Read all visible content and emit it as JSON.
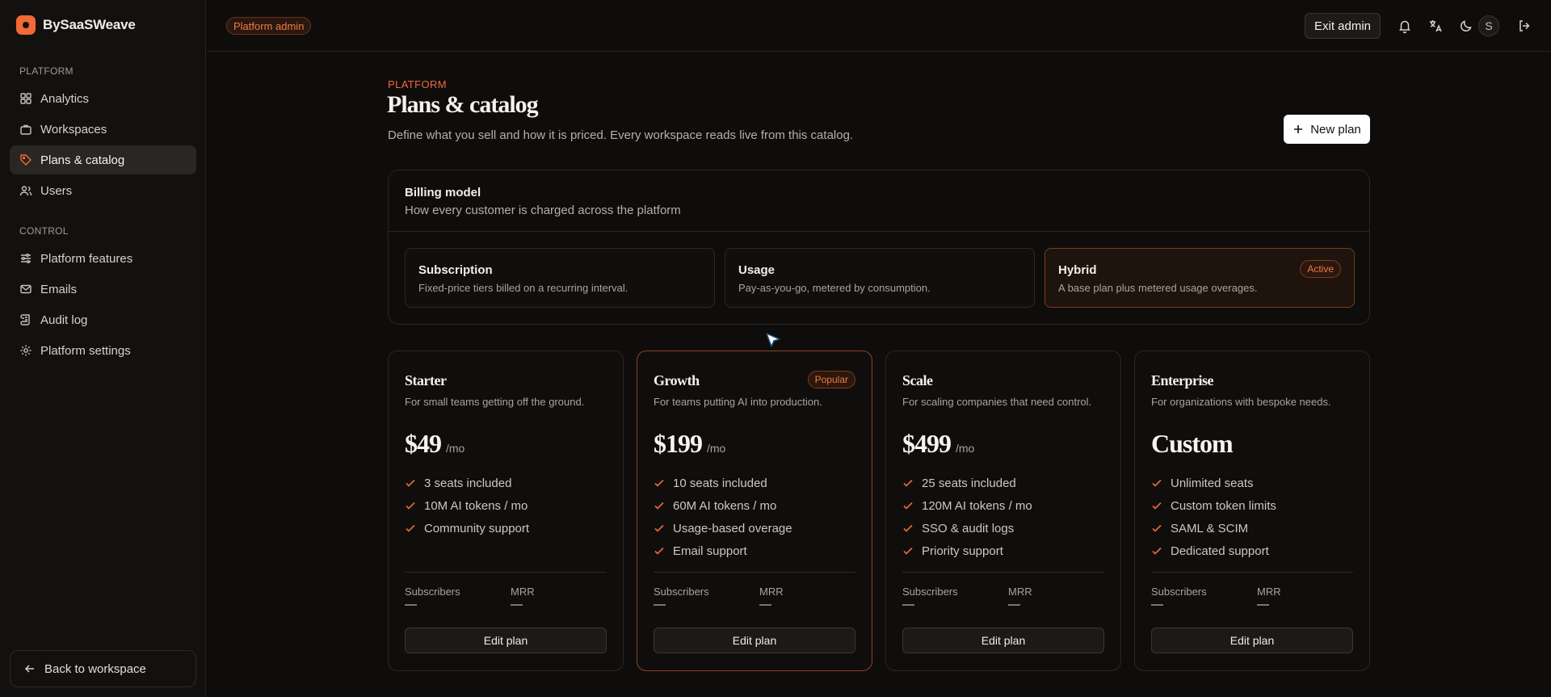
{
  "brand": {
    "name": "BySaaSWeave"
  },
  "sidebar": {
    "sections": [
      {
        "label": "PLATFORM",
        "items": [
          {
            "label": "Analytics",
            "icon": "grid-icon"
          },
          {
            "label": "Workspaces",
            "icon": "briefcase-icon"
          },
          {
            "label": "Plans & catalog",
            "icon": "tag-icon",
            "active": true
          },
          {
            "label": "Users",
            "icon": "users-icon"
          }
        ]
      },
      {
        "label": "CONTROL",
        "items": [
          {
            "label": "Platform features",
            "icon": "sliders-icon"
          },
          {
            "label": "Emails",
            "icon": "mail-icon"
          },
          {
            "label": "Audit log",
            "icon": "scroll-icon"
          },
          {
            "label": "Platform settings",
            "icon": "gear-icon"
          }
        ]
      }
    ],
    "back_label": "Back to workspace"
  },
  "topbar": {
    "admin_badge": "Platform admin",
    "exit_label": "Exit admin",
    "avatar_initial": "S"
  },
  "page": {
    "eyebrow": "PLATFORM",
    "title": "Plans & catalog",
    "subtitle": "Define what you sell and how it is priced. Every workspace reads live from this catalog.",
    "new_plan_label": "New plan"
  },
  "billing": {
    "title": "Billing model",
    "subtitle": "How every customer is charged across the platform",
    "models": [
      {
        "name": "Subscription",
        "desc": "Fixed-price tiers billed on a recurring interval."
      },
      {
        "name": "Usage",
        "desc": "Pay-as-you-go, metered by consumption."
      },
      {
        "name": "Hybrid",
        "desc": "A base plan plus metered usage overages.",
        "badge": "Active"
      }
    ]
  },
  "plans": [
    {
      "name": "Starter",
      "desc": "For small teams getting off the ground.",
      "price": "$49",
      "period": "/mo",
      "features": [
        "3 seats included",
        "10M AI tokens / mo",
        "Community support"
      ],
      "subscribers_label": "Subscribers",
      "subscribers": "—",
      "mrr_label": "MRR",
      "mrr": "—",
      "edit_label": "Edit plan"
    },
    {
      "name": "Growth",
      "desc": "For teams putting AI into production.",
      "price": "$199",
      "period": "/mo",
      "badge": "Popular",
      "features": [
        "10 seats included",
        "60M AI tokens / mo",
        "Usage-based overage",
        "Email support"
      ],
      "subscribers_label": "Subscribers",
      "subscribers": "—",
      "mrr_label": "MRR",
      "mrr": "—",
      "edit_label": "Edit plan"
    },
    {
      "name": "Scale",
      "desc": "For scaling companies that need control.",
      "price": "$499",
      "period": "/mo",
      "features": [
        "25 seats included",
        "120M AI tokens / mo",
        "SSO & audit logs",
        "Priority support"
      ],
      "subscribers_label": "Subscribers",
      "subscribers": "—",
      "mrr_label": "MRR",
      "mrr": "—",
      "edit_label": "Edit plan"
    },
    {
      "name": "Enterprise",
      "desc": "For organizations with bespoke needs.",
      "price": "Custom",
      "period": "",
      "features": [
        "Unlimited seats",
        "Custom token limits",
        "SAML & SCIM",
        "Dedicated support"
      ],
      "subscribers_label": "Subscribers",
      "subscribers": "—",
      "mrr_label": "MRR",
      "mrr": "—",
      "edit_label": "Edit plan"
    }
  ],
  "colors": {
    "accent": "#f06a33",
    "background": "#0e0d0c",
    "sidebar": "#131110"
  }
}
